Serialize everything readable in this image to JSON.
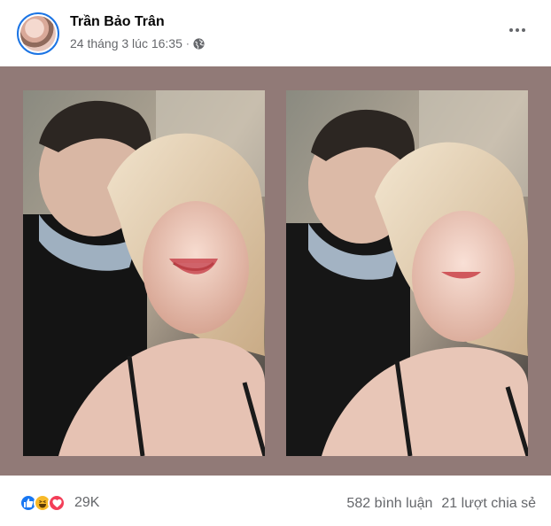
{
  "post": {
    "author": "Trần Bảo Trân",
    "timestamp": "24 tháng 3 lúc 16:35",
    "separator": "·",
    "privacy_icon": "globe-icon",
    "more_icon": "more-options-icon"
  },
  "photos": [
    {
      "name": "photo-1"
    },
    {
      "name": "photo-2"
    }
  ],
  "footer": {
    "reaction_icons": [
      "like-icon",
      "haha-icon",
      "love-icon"
    ],
    "reaction_count": "29K",
    "comments": "582 bình luận",
    "shares": "21 lượt chia sẻ"
  },
  "colors": {
    "photo_background": "#917a77",
    "like": "#1877f2",
    "haha": "#f7b928",
    "love": "#f33e58",
    "secondary_text": "#65676b"
  }
}
